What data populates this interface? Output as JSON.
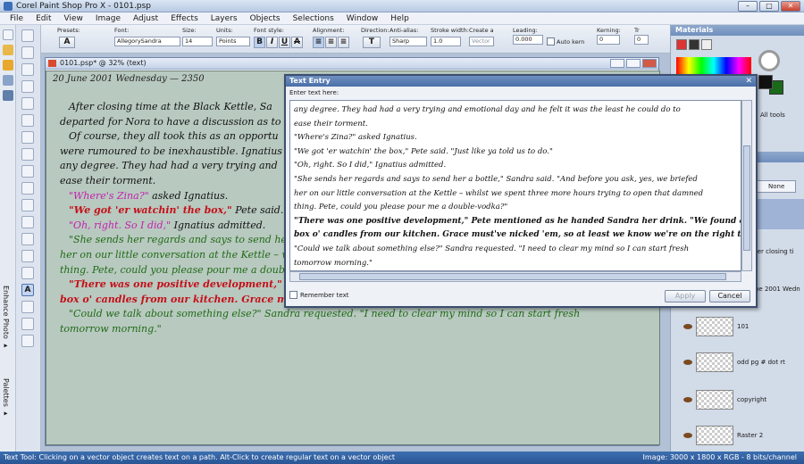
{
  "app": {
    "title": "Corel Paint Shop Pro X - 0101.psp"
  },
  "menu": [
    {
      "label": "File"
    },
    {
      "label": "Edit"
    },
    {
      "label": "View"
    },
    {
      "label": "Image"
    },
    {
      "label": "Adjust"
    },
    {
      "label": "Effects"
    },
    {
      "label": "Layers"
    },
    {
      "label": "Objects"
    },
    {
      "label": "Selections"
    },
    {
      "label": "Window"
    },
    {
      "label": "Help"
    }
  ],
  "tool_options": {
    "presets_label": "Presets:",
    "font_label": "Font:",
    "font_value": "AllegorySandra",
    "size_label": "Size:",
    "size_value": "14",
    "units_label": "Units:",
    "units_value": "Points",
    "font_style_label": "Font style:",
    "alignment_label": "Alignment:",
    "direction_label": "Direction:",
    "antialias_label": "Anti-alias:",
    "antialias_value": "Sharp",
    "stroke_label": "Stroke width:",
    "stroke_value": "1.0",
    "create_label": "Create a",
    "create_value": "Vector",
    "leading_label": "Leading:",
    "leading_value": "0.000",
    "autokern_label": "Auto kern",
    "kerning_label": "Kerning:",
    "kerning_value": "0",
    "tr_label": "Tr",
    "tr_value": "0"
  },
  "left_palette": {
    "enhance_label": "Enhance Photo ▸",
    "palettes_label": "Palettes ▸"
  },
  "document": {
    "title": "0101.psp* @  32% (text)",
    "dateline": "20 June 2001 Wednesday — 2350",
    "lines": [
      {
        "text": "After closing time at the Black Kettle, Sa",
        "style": "",
        "indent": true
      },
      {
        "text": "departed for Nora to have a discussion as to",
        "style": ""
      },
      {
        "text": "Of course, they all took this as an opportu",
        "style": "",
        "indent": true
      },
      {
        "text": "were rumoured to be inexhaustible. Ignatius",
        "style": ""
      },
      {
        "text": "any degree. They had had a very trying and",
        "style": ""
      },
      {
        "text": "ease their torment.",
        "style": ""
      },
      {
        "text": "\"Where's Zina?\"",
        "style": "ig",
        "tail": " asked Ignatius.",
        "indent": true
      },
      {
        "text": "\"We got 'er watchin' the box,\"",
        "style": "pt",
        "tail": " Pete said. \"",
        "indent": true
      },
      {
        "text": "\"Oh, right. So I did,\"",
        "style": "ig",
        "tail": " Ignatius admitted.",
        "indent": true
      },
      {
        "text": "\"She sends her regards and says to send her a b",
        "style": "sn",
        "indent": true
      },
      {
        "text": "her on our little conversation at the Kettle – whi",
        "style": "sn"
      },
      {
        "text": "thing. Pete, could you please pour me a double-vod",
        "style": "sn"
      },
      {
        "text": "\"There was one positive development,\" P",
        "style": "pt",
        "indent": true
      },
      {
        "text": "box o' candles from our kitchen. Grace must've nicked 'em, so at least we know we're on the right trail.\"",
        "style": "pt"
      },
      {
        "text": "\"Could we talk about something else?\" Sandra requested. \"I need to clear my mind so I can start fresh",
        "style": "sn",
        "indent": true
      },
      {
        "text": "tomorrow morning.\"",
        "style": "sn"
      }
    ]
  },
  "materials": {
    "title": "Materials",
    "all_tools": "All tools",
    "none_label": "None"
  },
  "layers": [
    {
      "name": "ter closing ti"
    },
    {
      "name": "ne 2001 Wedn"
    },
    {
      "name": "101"
    },
    {
      "name": "odd pg # dot rt"
    },
    {
      "name": "copyright"
    },
    {
      "name": "Raster 2"
    }
  ],
  "dialog": {
    "title": "Text Entry",
    "prompt": "Enter text here:",
    "lines": [
      "any degree. They had had a very trying and emotional day and he felt it was the least he could do to",
      "ease their torment.",
      "  \"Where's Zina?\" asked Ignatius.",
      "  \"We got 'er watchin' the box,\" Pete said. \"Just like ya told us to do.\"",
      "  \"Oh, right. So I did,\" Ignatius admitted.",
      "  \"She sends her regards and says to send her a bottle,\" Sandra said. \"And before you ask, yes, we briefed",
      "her on our little conversation at the Kettle – whilst we spent three more hours trying to open that damned",
      "thing. Pete, could you please pour me a double-vodka?\"",
      "  \"There was one positive development,\" Pete mentioned as he handed Sandra her drink. \"We found a",
      "box o' candles from our kitchen. Grace must've nicked 'em, so at least we know we're on the right trail.\"",
      "  \"Could we talk about something else?\" Sandra requested. \"I need to clear my mind so I can start fresh",
      "tomorrow morning.\""
    ],
    "remember_label": "Remember text",
    "apply_label": "Apply",
    "cancel_label": "Cancel"
  },
  "status": {
    "left": "Text Tool: Clicking on a vector object creates text on a path. Alt-Click to create regular text on a vector object",
    "right": "Image: 3000 x 1800 x RGB - 8 bits/channel"
  }
}
